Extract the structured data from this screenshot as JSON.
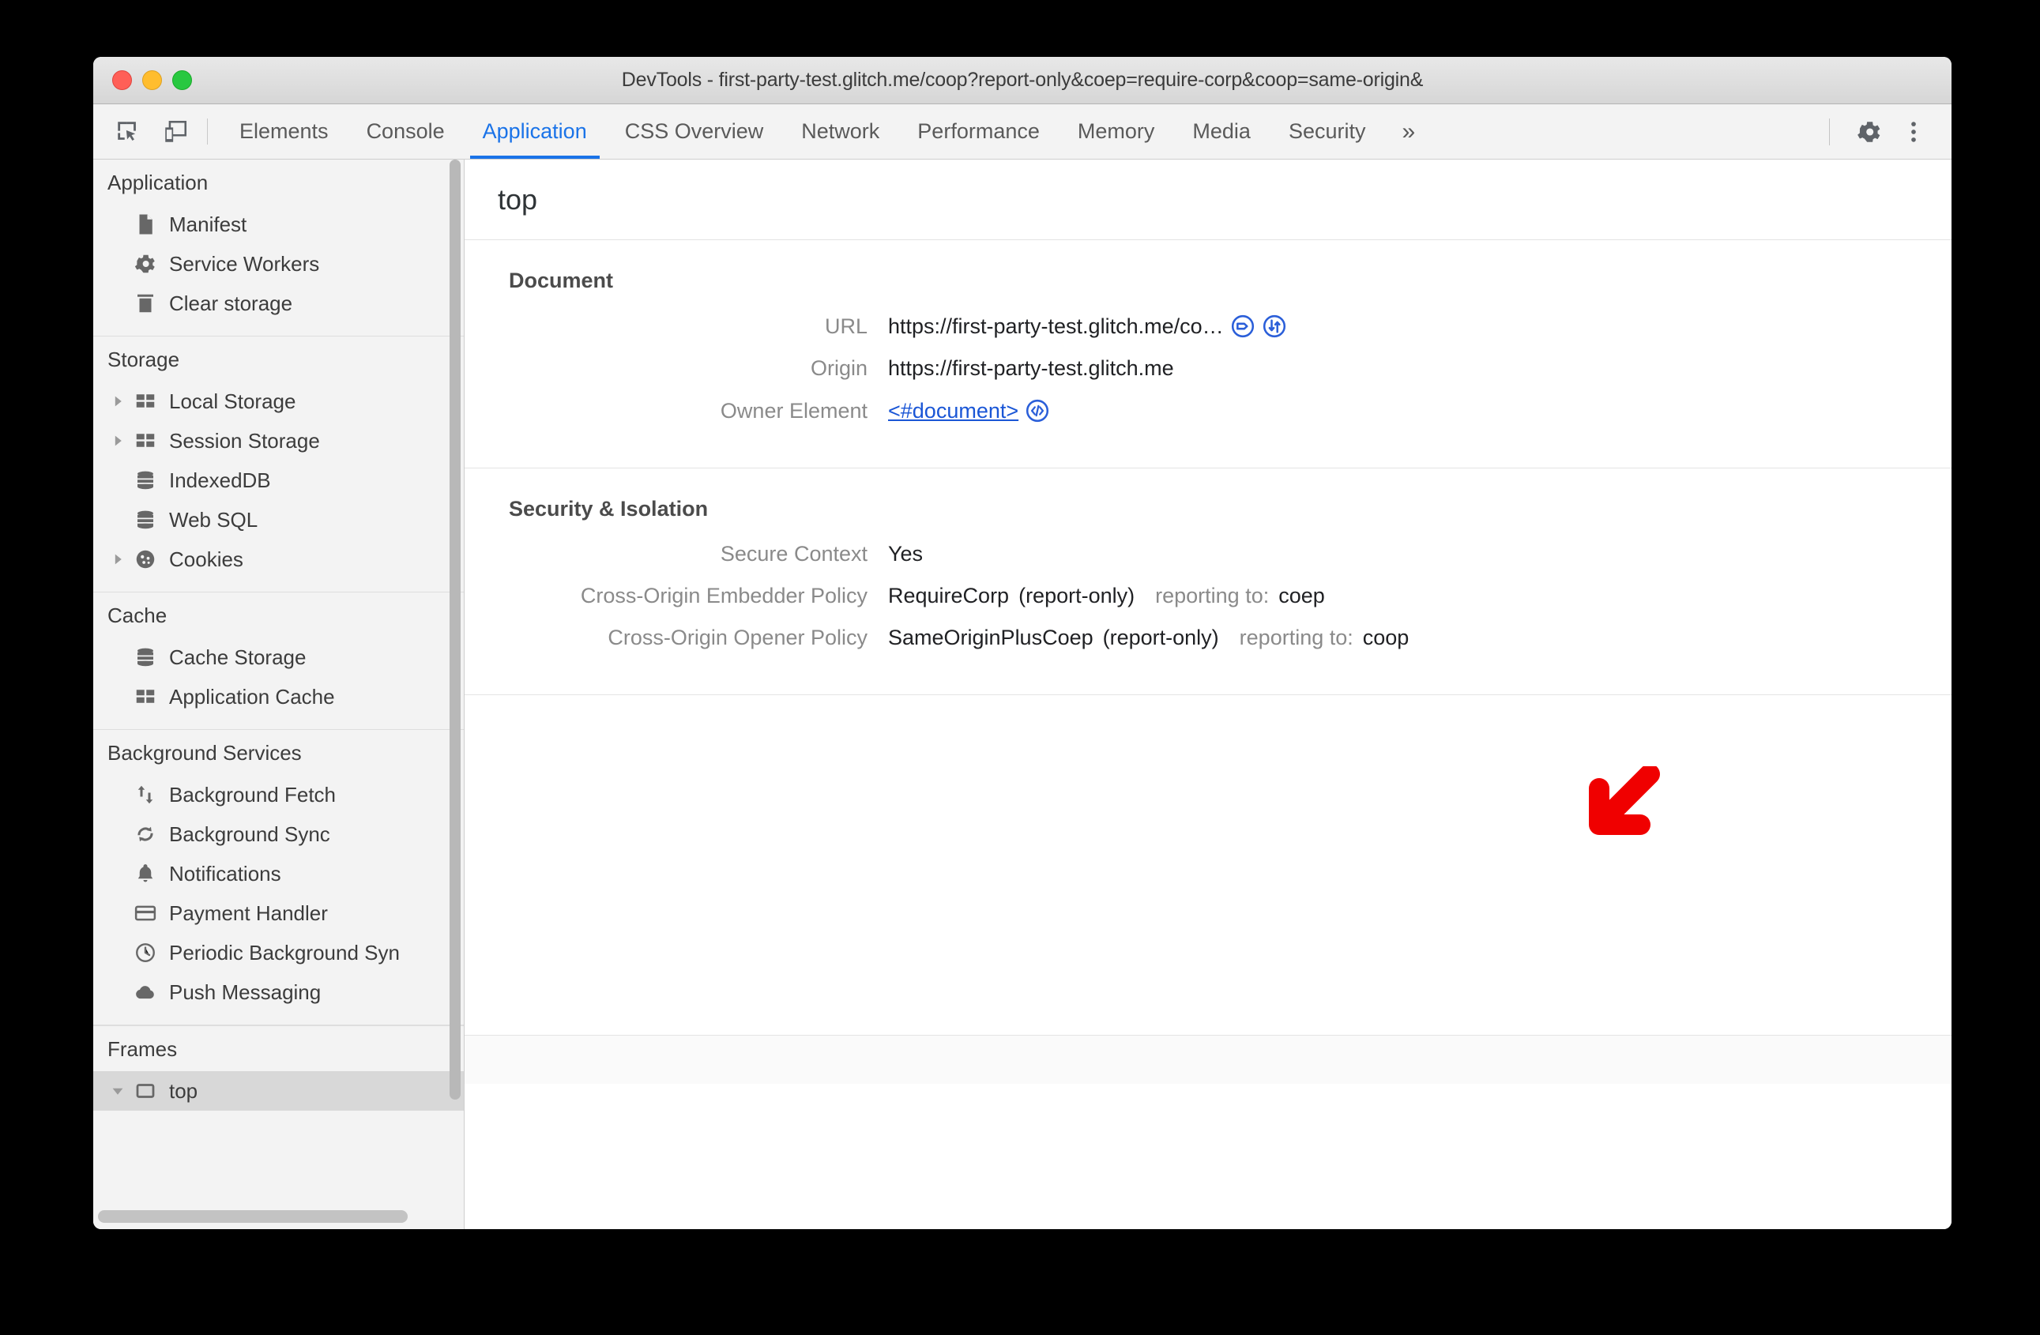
{
  "window": {
    "title": "DevTools - first-party-test.glitch.me/coop?report-only&coep=require-corp&coop=same-origin&"
  },
  "toolbar": {
    "inspect_icon": "inspect-element-icon",
    "device_icon": "device-toolbar-icon",
    "settings_icon": "gear-icon",
    "more_icon": "kebab-menu-icon",
    "more_tabs_label": "»",
    "tabs": [
      {
        "label": "Elements",
        "active": false
      },
      {
        "label": "Console",
        "active": false
      },
      {
        "label": "Application",
        "active": true
      },
      {
        "label": "CSS Overview",
        "active": false
      },
      {
        "label": "Network",
        "active": false
      },
      {
        "label": "Performance",
        "active": false
      },
      {
        "label": "Memory",
        "active": false
      },
      {
        "label": "Media",
        "active": false
      },
      {
        "label": "Security",
        "active": false
      }
    ]
  },
  "sidebar": {
    "sections": [
      {
        "title": "Application",
        "items": [
          {
            "label": "Manifest",
            "icon": "document-icon",
            "twisty": "none",
            "selected": false
          },
          {
            "label": "Service Workers",
            "icon": "gear-icon",
            "twisty": "none",
            "selected": false
          },
          {
            "label": "Clear storage",
            "icon": "trash-icon",
            "twisty": "none",
            "selected": false
          }
        ]
      },
      {
        "title": "Storage",
        "items": [
          {
            "label": "Local Storage",
            "icon": "table-icon",
            "twisty": "collapsed",
            "selected": false
          },
          {
            "label": "Session Storage",
            "icon": "table-icon",
            "twisty": "collapsed",
            "selected": false
          },
          {
            "label": "IndexedDB",
            "icon": "database-icon",
            "twisty": "none",
            "selected": false
          },
          {
            "label": "Web SQL",
            "icon": "database-icon",
            "twisty": "none",
            "selected": false
          },
          {
            "label": "Cookies",
            "icon": "cookie-icon",
            "twisty": "collapsed",
            "selected": false
          }
        ]
      },
      {
        "title": "Cache",
        "items": [
          {
            "label": "Cache Storage",
            "icon": "database-icon",
            "twisty": "none",
            "selected": false
          },
          {
            "label": "Application Cache",
            "icon": "table-icon",
            "twisty": "none",
            "selected": false
          }
        ]
      },
      {
        "title": "Background Services",
        "items": [
          {
            "label": "Background Fetch",
            "icon": "updown-arrows-icon",
            "twisty": "none",
            "selected": false
          },
          {
            "label": "Background Sync",
            "icon": "sync-icon",
            "twisty": "none",
            "selected": false
          },
          {
            "label": "Notifications",
            "icon": "bell-icon",
            "twisty": "none",
            "selected": false
          },
          {
            "label": "Payment Handler",
            "icon": "credit-card-icon",
            "twisty": "none",
            "selected": false
          },
          {
            "label": "Periodic Background Syn",
            "icon": "clock-icon",
            "twisty": "none",
            "selected": false
          },
          {
            "label": "Push Messaging",
            "icon": "cloud-icon",
            "twisty": "none",
            "selected": false
          }
        ]
      },
      {
        "title": "Frames",
        "items": [
          {
            "label": "top",
            "icon": "frame-icon",
            "twisty": "expanded",
            "selected": true
          }
        ]
      }
    ]
  },
  "main": {
    "header": "top",
    "document_group": {
      "title": "Document",
      "url_label": "URL",
      "url_value": "https://first-party-test.glitch.me/co…",
      "url_icon_1": "open-in-sources-icon",
      "url_icon_2": "open-in-network-icon",
      "origin_label": "Origin",
      "origin_value": "https://first-party-test.glitch.me",
      "owner_label": "Owner Element",
      "owner_value": "<#document>",
      "owner_icon": "code-brackets-icon"
    },
    "security_group": {
      "title": "Security & Isolation",
      "secure_context_label": "Secure Context",
      "secure_context_value": "Yes",
      "coep_label": "Cross-Origin Embedder Policy",
      "coep_value": "RequireCorp",
      "coep_mode": "(report-only)",
      "coep_reporting_prefix": "reporting to:",
      "coep_reporting_value": "coep",
      "coop_label": "Cross-Origin Opener Policy",
      "coop_value": "SameOriginPlusCoep",
      "coop_mode": "(report-only)",
      "coop_reporting_prefix": "reporting to:",
      "coop_reporting_value": "coop"
    }
  },
  "annotation": {
    "arrow_icon": "red-arrow-down-left-icon",
    "arrow_color": "#f00000"
  },
  "colors": {
    "accent_blue": "#1a73e8",
    "link_blue": "#1a56d6",
    "annotation_red": "#f00000",
    "text_primary": "#202124",
    "text_muted": "#8a8a8a",
    "sidebar_bg": "#f3f3f3",
    "selected_bg": "#d8d8d8"
  }
}
